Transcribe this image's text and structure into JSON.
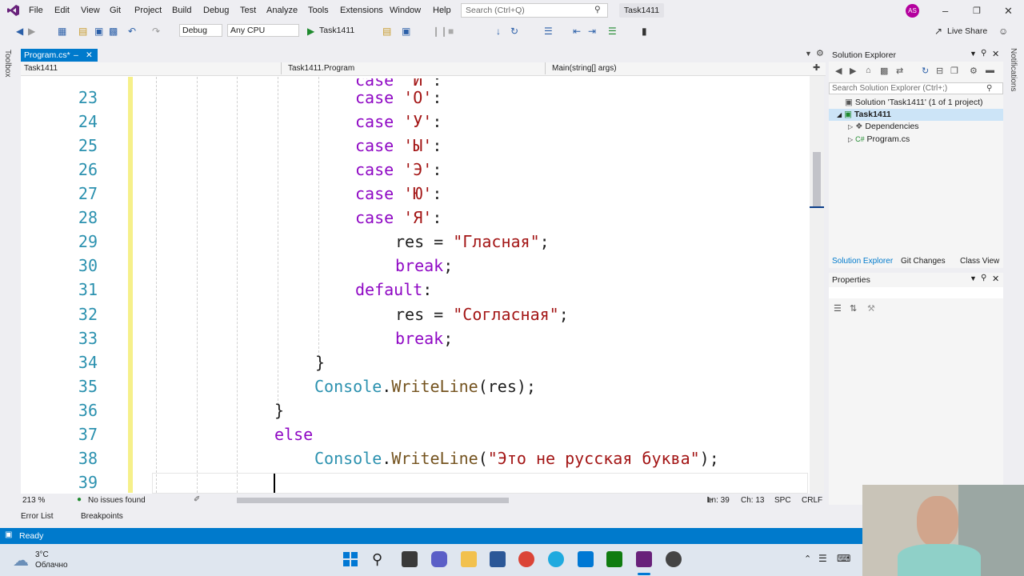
{
  "menu": [
    "File",
    "Edit",
    "View",
    "Git",
    "Project",
    "Build",
    "Debug",
    "Test",
    "Analyze",
    "Tools",
    "Extensions",
    "Window",
    "Help"
  ],
  "search_placeholder": "Search (Ctrl+Q)",
  "solution_name": "Task1411",
  "avatar_initials": "AS",
  "toolbar": {
    "config": "Debug",
    "platform": "Any CPU",
    "run_target": "Task1411",
    "live_share": "Live Share"
  },
  "left_rail_label": "Toolbox",
  "right_rail_label": "Notifications",
  "tab": {
    "label": "Program.cs*"
  },
  "nav": {
    "project": "Task1411",
    "class": "Task1411.Program",
    "member": "Main(string[] args)"
  },
  "code_lines": [
    {
      "n": "23",
      "text": "case 'О':"
    },
    {
      "n": "24",
      "text": "case 'У':"
    },
    {
      "n": "25",
      "text": "case 'Ы':"
    },
    {
      "n": "26",
      "text": "case 'Э':"
    },
    {
      "n": "27",
      "text": "case 'Ю':"
    },
    {
      "n": "28",
      "text": "case 'Я':"
    },
    {
      "n": "29",
      "text": "res = \"Гласная\";"
    },
    {
      "n": "30",
      "text": "break;"
    },
    {
      "n": "31",
      "text": "default:"
    },
    {
      "n": "32",
      "text": "res = \"Согласная\";"
    },
    {
      "n": "33",
      "text": "break;"
    },
    {
      "n": "34",
      "text": "}"
    },
    {
      "n": "35",
      "text": "Console.WriteLine(res);"
    },
    {
      "n": "36",
      "text": "}"
    },
    {
      "n": "37",
      "text": "else"
    },
    {
      "n": "38",
      "text": "Console.WriteLine(\"Это не русская буква\");"
    },
    {
      "n": "39",
      "text": ""
    }
  ],
  "editor_status": {
    "zoom": "213 %",
    "issues": "No issues found",
    "line": "Ln: 39",
    "col": "Ch: 13",
    "spacing": "SPC",
    "eol": "CRLF"
  },
  "bottom_tabs": [
    "Error List",
    "Breakpoints"
  ],
  "solution_explorer": {
    "title": "Solution Explorer",
    "search_placeholder": "Search Solution Explorer (Ctrl+;)",
    "solution": "Solution 'Task1411' (1 of 1 project)",
    "project": "Task1411",
    "dependencies": "Dependencies",
    "file": "Program.cs",
    "tabs": [
      "Solution Explorer",
      "Git Changes",
      "Class View"
    ]
  },
  "properties": {
    "title": "Properties"
  },
  "status": {
    "text": "Ready"
  },
  "weather": {
    "temp": "3°C",
    "condition": "Облачно"
  },
  "colors": {
    "accent": "#007acc",
    "keyword": "#8f08c4",
    "string": "#a31515",
    "type": "#2b91af",
    "line_number": "#2b91af"
  }
}
